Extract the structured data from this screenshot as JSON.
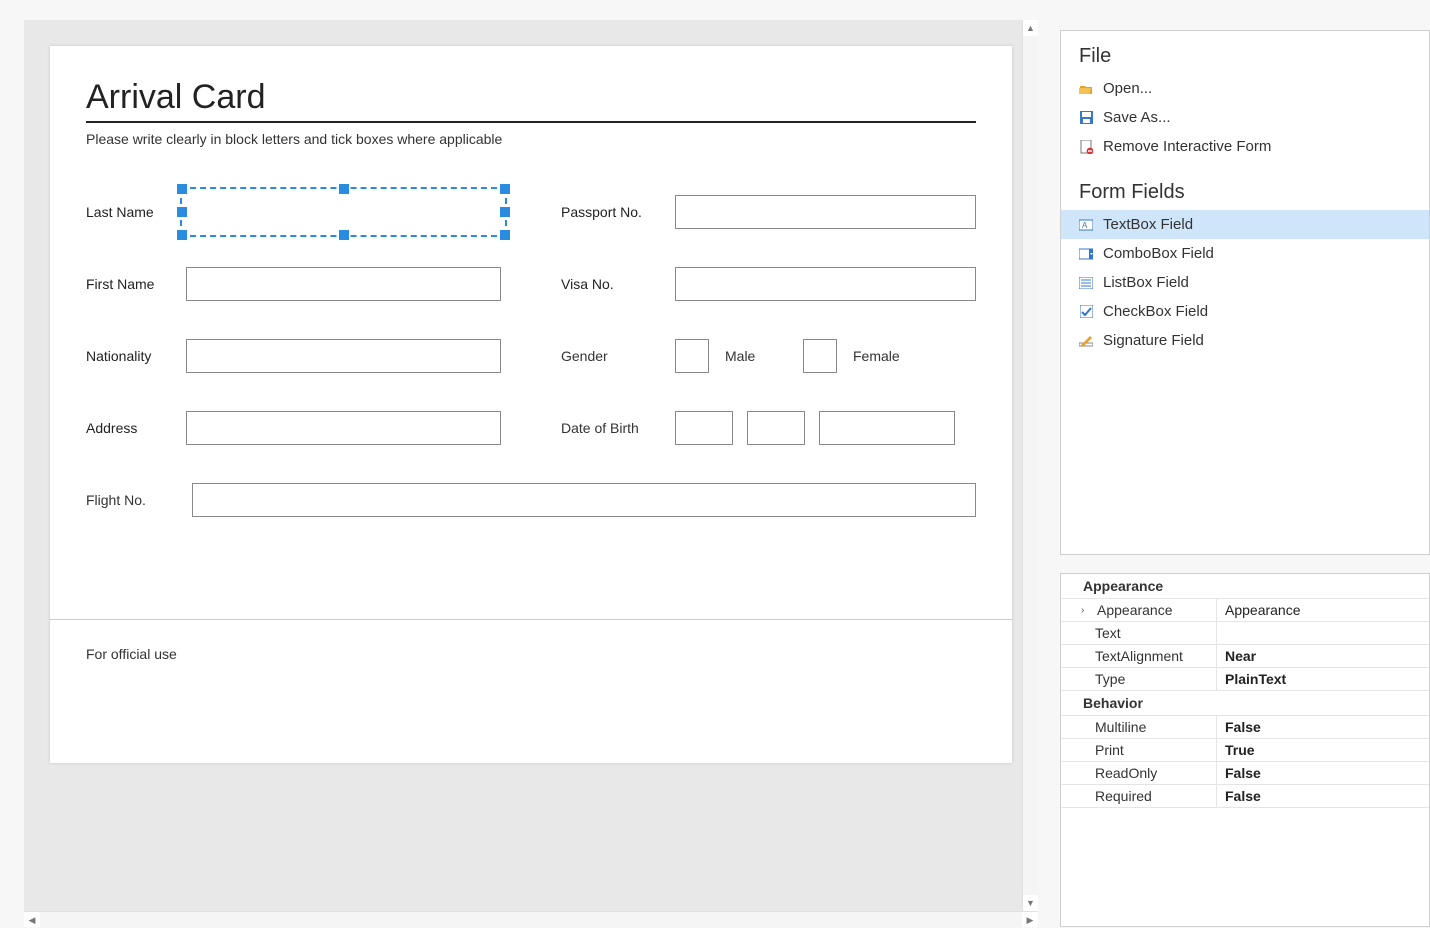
{
  "document": {
    "title": "Arrival Card",
    "subtitle": "Please write clearly in block letters and tick boxes where applicable",
    "fields": {
      "lastName": "Last Name",
      "firstName": "First Name",
      "nationality": "Nationality",
      "address": "Address",
      "passportNo": "Passport No.",
      "visaNo": "Visa No.",
      "gender": "Gender",
      "male": "Male",
      "female": "Female",
      "dob": "Date of Birth",
      "flightNo": "Flight No."
    },
    "official": "For official use"
  },
  "filePanel": {
    "heading": "File",
    "open": "Open...",
    "saveAs": "Save As...",
    "remove": "Remove Interactive Form"
  },
  "fieldsPanel": {
    "heading": "Form Fields",
    "textbox": "TextBox Field",
    "combobox": "ComboBox Field",
    "listbox": "ListBox Field",
    "checkbox": "CheckBox Field",
    "signature": "Signature Field"
  },
  "props": {
    "appearanceGroup": "Appearance",
    "appearanceK": "Appearance",
    "appearanceV": "Appearance",
    "textK": "Text",
    "textV": "",
    "alignK": "TextAlignment",
    "alignV": "Near",
    "typeK": "Type",
    "typeV": "PlainText",
    "behaviorGroup": "Behavior",
    "multilineK": "Multiline",
    "multilineV": "False",
    "printK": "Print",
    "printV": "True",
    "readonlyK": "ReadOnly",
    "readonlyV": "False",
    "requiredK": "Required",
    "requiredV": "False"
  }
}
